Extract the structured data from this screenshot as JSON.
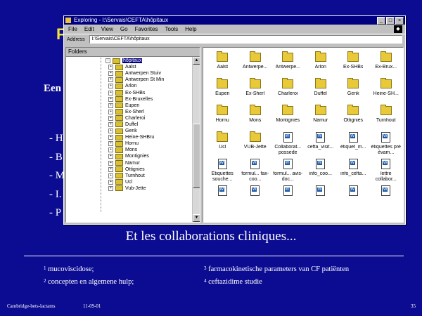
{
  "slide": {
    "title_fragment": "F",
    "heading_fragment": "Een",
    "bullets": [
      "- H",
      "- B",
      "- M",
      "- I.",
      "- P"
    ],
    "subtitle": "Et les collaborations cliniques...",
    "footnotes": [
      {
        "num": "1",
        "text": "mucoviscidose;"
      },
      {
        "num": "2",
        "text": "concepten en algemene hulp;"
      },
      {
        "num": "3",
        "text": "farmacokinetische parameters van CF patiënten"
      },
      {
        "num": "4",
        "text": "ceftazidime studie"
      }
    ],
    "footer_left": "Cambridge-bets-lactams",
    "footer_date": "11-09-01",
    "footer_page": "35"
  },
  "explorer": {
    "title": "Exploring - I:\\Servais\\CEFTA\\hôpitaux",
    "menu": [
      "File",
      "Edit",
      "View",
      "Go",
      "Favorites",
      "Tools",
      "Help"
    ],
    "address_label": "Address",
    "address_value": "I:\\Servais\\CEFTA\\hôpitaux",
    "folders_label": "Folders",
    "tree": [
      "hôpitaux",
      "Aalst",
      "Antwerpen Stuiv",
      "Antwerpen St Min",
      "Arlon",
      "Ex-SHBs",
      "Ex-Bruxelles",
      "Eupen",
      "Ex-Sherl",
      "Charleroi",
      "Duffel",
      "Genk",
      "Heine-SHBru",
      "Hornu",
      "Mons",
      "Montignies",
      "Namur",
      "Ottignies",
      "Turnhout",
      "Ucl",
      "Vub-Jette"
    ],
    "items": [
      {
        "label": "Aalst",
        "type": "folder"
      },
      {
        "label": "Antwerpe...",
        "type": "folder"
      },
      {
        "label": "Antwerpe...",
        "type": "folder"
      },
      {
        "label": "Arlon",
        "type": "folder"
      },
      {
        "label": "Ex-SHBs",
        "type": "folder"
      },
      {
        "label": "Ex-Brux...",
        "type": "folder"
      },
      {
        "label": "Eupen",
        "type": "folder"
      },
      {
        "label": "Ex-Sherl",
        "type": "folder"
      },
      {
        "label": "Charleroi",
        "type": "folder"
      },
      {
        "label": "Duffel",
        "type": "folder"
      },
      {
        "label": "Genk",
        "type": "folder"
      },
      {
        "label": "Heine-SH...",
        "type": "folder"
      },
      {
        "label": "Hornu",
        "type": "folder"
      },
      {
        "label": "Mons",
        "type": "folder"
      },
      {
        "label": "Montignies",
        "type": "folder"
      },
      {
        "label": "Namur",
        "type": "folder"
      },
      {
        "label": "Ottignies",
        "type": "folder"
      },
      {
        "label": "Turnhout",
        "type": "folder"
      },
      {
        "label": "Ucl",
        "type": "folder"
      },
      {
        "label": "VUB-Jette",
        "type": "folder"
      },
      {
        "label": "Collaborat... possede",
        "type": "doc"
      },
      {
        "label": "cefta_visit...",
        "type": "doc"
      },
      {
        "label": "étiquet_m...",
        "type": "doc"
      },
      {
        "label": "étiquettes pré évam...",
        "type": "doc"
      },
      {
        "label": "Etiquettes souche...",
        "type": "doc"
      },
      {
        "label": "formul... fax-coo...",
        "type": "doc"
      },
      {
        "label": "formul... avis-doc...",
        "type": "doc"
      },
      {
        "label": "info_coo...",
        "type": "doc"
      },
      {
        "label": "info_cefta...",
        "type": "doc"
      },
      {
        "label": "lettre collabor...",
        "type": "doc"
      },
      {
        "label": "",
        "type": "doc"
      },
      {
        "label": "",
        "type": "doc"
      },
      {
        "label": "",
        "type": "doc"
      },
      {
        "label": "",
        "type": "doc"
      },
      {
        "label": "",
        "type": "doc"
      },
      {
        "label": "",
        "type": "doc"
      }
    ]
  }
}
